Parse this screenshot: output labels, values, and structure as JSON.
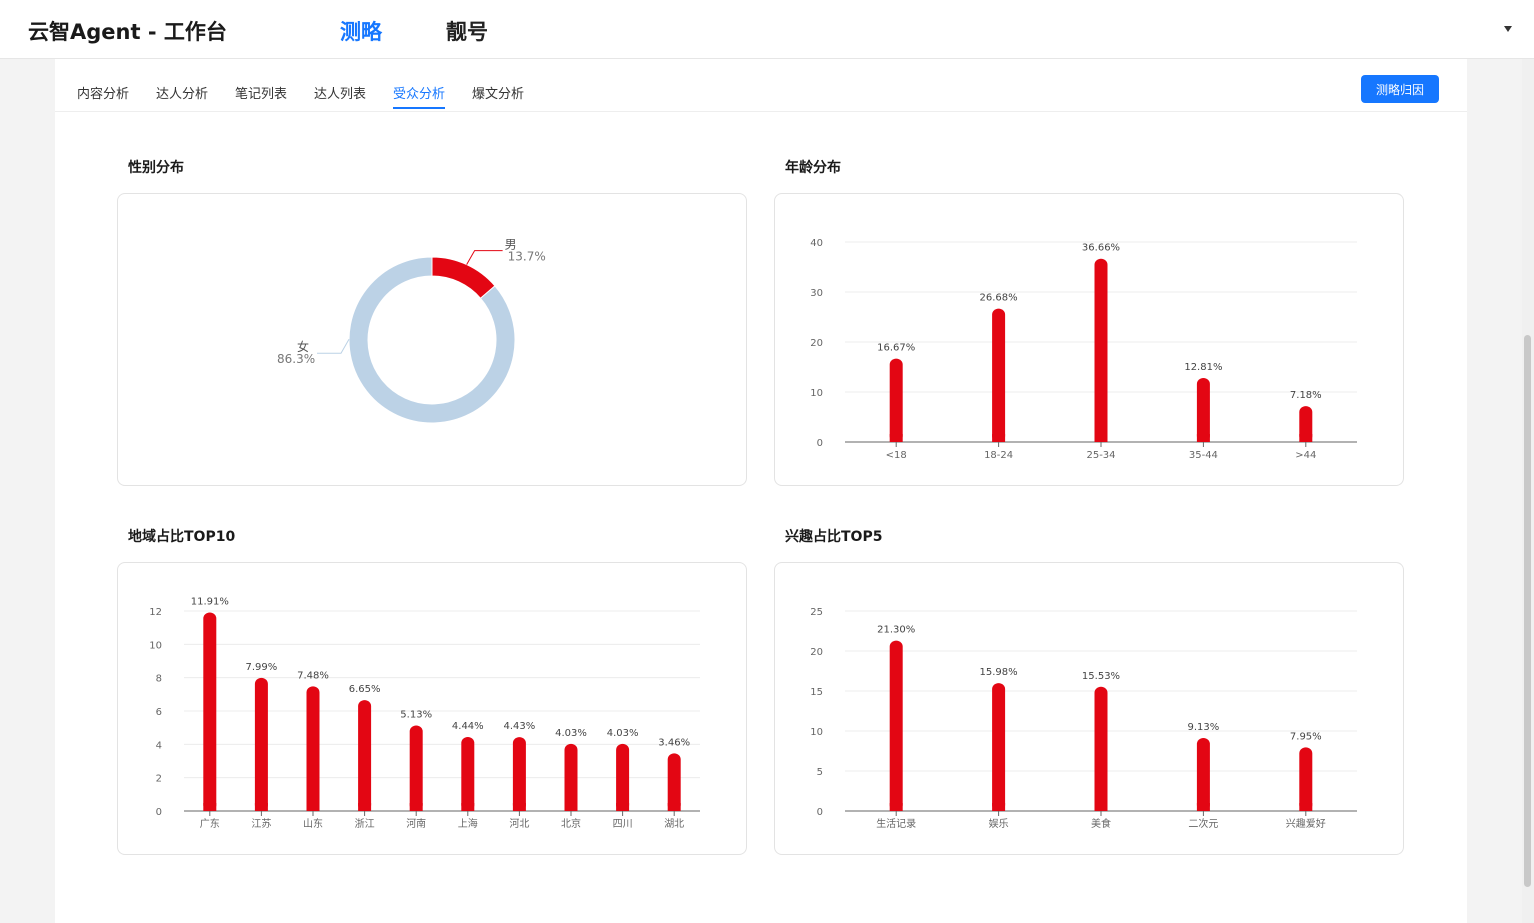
{
  "header": {
    "title": "云智Agent - 工作台",
    "nav": [
      {
        "label": "测略",
        "active": true
      },
      {
        "label": "靓号",
        "active": false
      }
    ]
  },
  "tabs": [
    {
      "label": "内容分析",
      "active": false
    },
    {
      "label": "达人分析",
      "active": false
    },
    {
      "label": "笔记列表",
      "active": false
    },
    {
      "label": "达人列表",
      "active": false
    },
    {
      "label": "受众分析",
      "active": true
    },
    {
      "label": "爆文分析",
      "active": false
    }
  ],
  "actions": {
    "attribution_button": "测略归因"
  },
  "colors": {
    "accent": "#1677ff",
    "bar": "#e30613",
    "donut_female": "#bcd2e6",
    "donut_male": "#e30613"
  },
  "sections": {
    "gender": {
      "title": "性别分布"
    },
    "age": {
      "title": "年龄分布"
    },
    "region": {
      "title": "地域占比TOP10"
    },
    "interest": {
      "title": "兴趣占比TOP5"
    }
  },
  "chart_data": [
    {
      "id": "gender",
      "type": "pie",
      "slices": [
        {
          "name": "男",
          "value": 13.7,
          "label": "13.7%"
        },
        {
          "name": "女",
          "value": 86.3,
          "label": "86.3%"
        }
      ]
    },
    {
      "id": "age",
      "type": "bar",
      "categories": [
        "<18",
        "18-24",
        "25-34",
        "35-44",
        ">44"
      ],
      "values": [
        16.67,
        26.68,
        36.66,
        12.81,
        7.18
      ],
      "labels": [
        "16.67%",
        "26.68%",
        "36.66%",
        "12.81%",
        "7.18%"
      ],
      "ylim": [
        0,
        40
      ],
      "yticks": [
        0,
        10,
        20,
        30,
        40
      ],
      "grid": true
    },
    {
      "id": "region",
      "type": "bar",
      "categories": [
        "广东",
        "江苏",
        "山东",
        "浙江",
        "河南",
        "上海",
        "河北",
        "北京",
        "四川",
        "湖北"
      ],
      "values": [
        11.91,
        7.99,
        7.48,
        6.65,
        5.13,
        4.44,
        4.43,
        4.03,
        4.03,
        3.46
      ],
      "labels": [
        "11.91%",
        "7.99%",
        "7.48%",
        "6.65%",
        "5.13%",
        "4.44%",
        "4.43%",
        "4.03%",
        "4.03%",
        "3.46%"
      ],
      "ylim": [
        0,
        12
      ],
      "yticks": [
        0,
        2,
        4,
        6,
        8,
        10,
        12
      ],
      "grid": true
    },
    {
      "id": "interest",
      "type": "bar",
      "categories": [
        "生活记录",
        "娱乐",
        "美食",
        "二次元",
        "兴趣爱好"
      ],
      "values": [
        21.3,
        15.98,
        15.53,
        9.13,
        7.95
      ],
      "labels": [
        "21.30%",
        "15.98%",
        "15.53%",
        "9.13%",
        "7.95%"
      ],
      "ylim": [
        0,
        25
      ],
      "yticks": [
        0,
        5,
        10,
        15,
        20,
        25
      ],
      "grid": true
    }
  ]
}
